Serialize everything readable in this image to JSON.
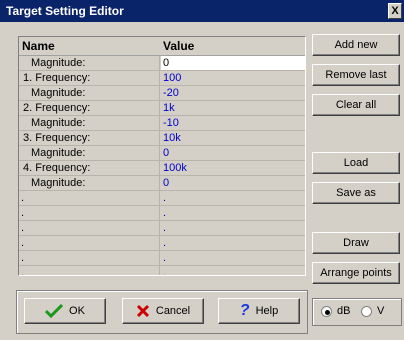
{
  "window": {
    "title": "Target Setting Editor",
    "close_label": "X"
  },
  "table": {
    "headers": [
      "Name",
      "Value"
    ],
    "rows": [
      {
        "name": "Magnitude:",
        "value": "0"
      },
      {
        "name": "1.  Frequency:",
        "value": "100"
      },
      {
        "name": "Magnitude:",
        "value": "-20"
      },
      {
        "name": "2.  Frequency:",
        "value": "1k"
      },
      {
        "name": "Magnitude:",
        "value": "-10"
      },
      {
        "name": "3.  Frequency:",
        "value": "10k"
      },
      {
        "name": "Magnitude:",
        "value": "0"
      },
      {
        "name": "4.  Frequency:",
        "value": "100k"
      },
      {
        "name": "Magnitude:",
        "value": "0"
      },
      {
        "name": ".",
        "value": "."
      },
      {
        "name": ".",
        "value": "."
      },
      {
        "name": ".",
        "value": "."
      },
      {
        "name": ".",
        "value": "."
      },
      {
        "name": ".",
        "value": "."
      },
      {
        "name": ".",
        "value": "."
      },
      {
        "name": ".",
        "value": "."
      }
    ]
  },
  "buttons": {
    "add_new": "Add new",
    "remove_last": "Remove last",
    "clear_all": "Clear all",
    "load": "Load",
    "save_as": "Save as",
    "draw": "Draw",
    "arrange_points": "Arrange points",
    "ok": "OK",
    "cancel": "Cancel",
    "help": "Help"
  },
  "units": {
    "db_label": "dB",
    "v_label": "V",
    "selected": "dB"
  },
  "colors": {
    "title_bar": "#0a246a",
    "value_text": "#0000cc",
    "ok_check": "#1a9a1a",
    "cancel_x": "#cc0000",
    "help_q": "#1a3adc"
  }
}
